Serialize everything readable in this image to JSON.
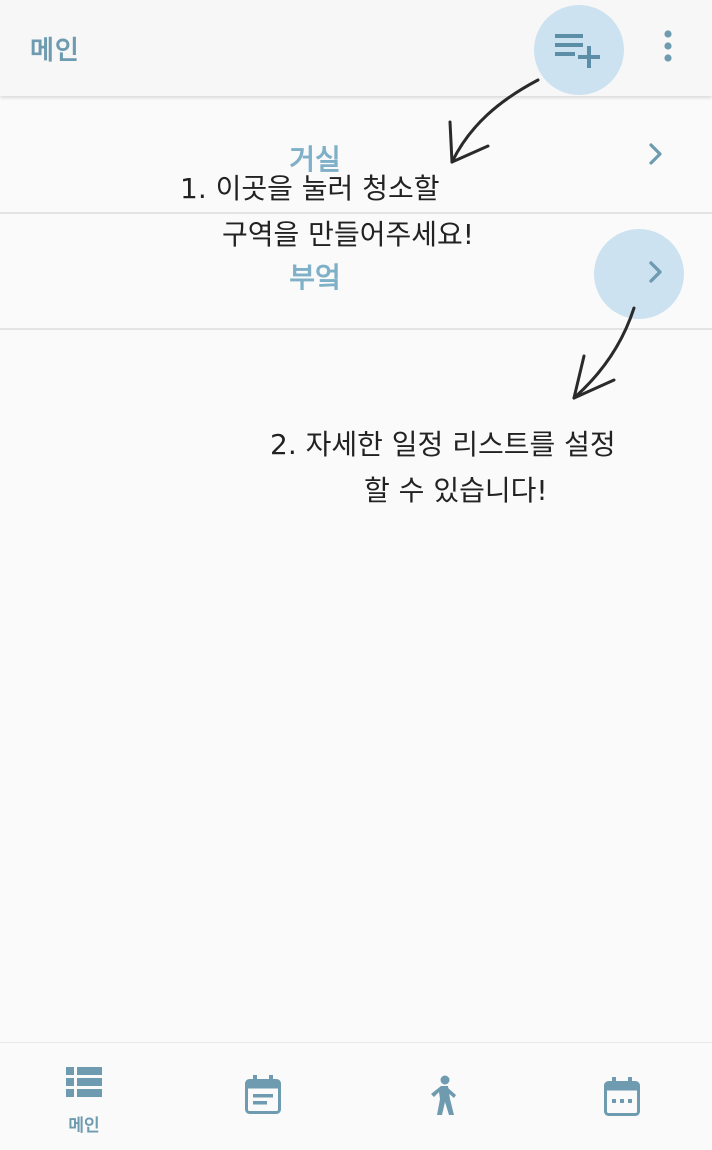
{
  "appbar": {
    "title": "메인",
    "add_icon": "playlist-add-icon",
    "more_icon": "more-vert-icon"
  },
  "rooms": [
    {
      "label": "거실",
      "chevron_icon": "chevron-right-icon"
    },
    {
      "label": "부엌",
      "chevron_icon": "chevron-right-icon"
    }
  ],
  "annotations": {
    "step1_line1": "1. 이곳을 눌러 청소할",
    "step1_line2": "구역을 만들어주세요!",
    "step2_line1": "2. 자세한 일정 리스트를 설정",
    "step2_line2": "할 수 있습니다!"
  },
  "bottom_nav": [
    {
      "label": "메인",
      "icon": "view-list-icon"
    },
    {
      "label": "",
      "icon": "event-note-icon"
    },
    {
      "label": "",
      "icon": "walking-icon"
    },
    {
      "label": "",
      "icon": "calendar-dots-icon"
    }
  ],
  "colors": {
    "accent": "#6f9bb0",
    "highlight": "#cce2f0",
    "room_label": "#7fb0c8"
  }
}
